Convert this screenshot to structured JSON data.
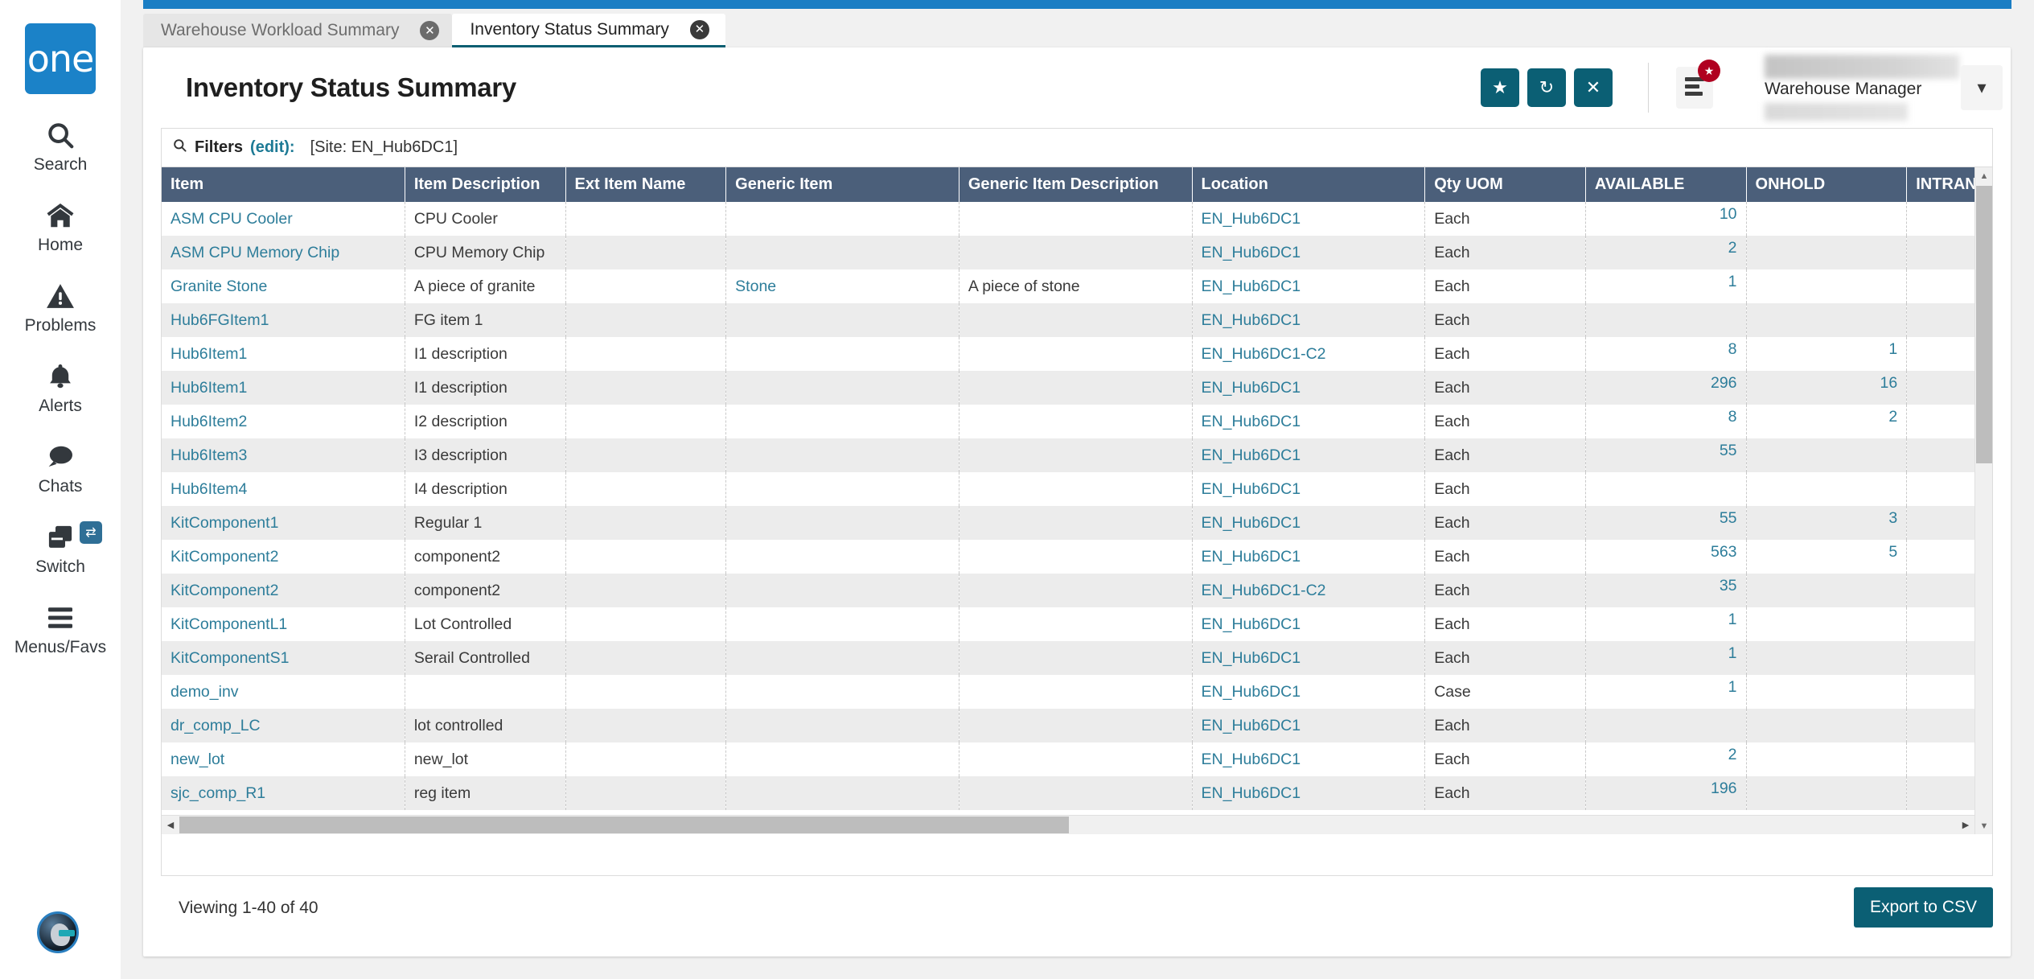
{
  "brand": {
    "logo_text": "one"
  },
  "sidebar": {
    "items": [
      {
        "label": "Search",
        "icon": "search-icon"
      },
      {
        "label": "Home",
        "icon": "home-icon"
      },
      {
        "label": "Problems",
        "icon": "warning-triangle-icon"
      },
      {
        "label": "Alerts",
        "icon": "bell-icon"
      },
      {
        "label": "Chats",
        "icon": "chat-bubble-icon"
      },
      {
        "label": "Switch",
        "icon": "windows-switch-icon",
        "badge_icon": "swap-arrows-icon"
      },
      {
        "label": "Menus/Favs",
        "icon": "hamburger-icon"
      }
    ]
  },
  "tabs": [
    {
      "label": "Warehouse Workload Summary",
      "active": false,
      "close_icon": "close-circle-icon"
    },
    {
      "label": "Inventory Status Summary",
      "active": true,
      "close_icon": "close-circle-icon"
    }
  ],
  "header": {
    "title": "Inventory Status Summary",
    "actions": [
      {
        "name": "favorite-button",
        "icon": "star-icon",
        "glyph": "★"
      },
      {
        "name": "refresh-button",
        "icon": "refresh-icon",
        "glyph": "↻"
      },
      {
        "name": "close-button",
        "icon": "x-icon",
        "glyph": "✕"
      }
    ],
    "menu_button": {
      "icon": "menu-list-icon",
      "badge_icon": "star-badge-icon",
      "badge_glyph": "★"
    },
    "user": {
      "role": "Warehouse Manager",
      "caret_icon": "chevron-down-icon",
      "caret_glyph": "▾"
    }
  },
  "filters": {
    "icon": "search-icon",
    "label": "Filters",
    "edit_link": "(edit):",
    "value": "[Site: EN_Hub6DC1]"
  },
  "table": {
    "columns": [
      "Item",
      "Item Description",
      "Ext Item Name",
      "Generic Item",
      "Generic Item Description",
      "Location",
      "Qty UOM",
      "AVAILABLE",
      "ONHOLD",
      "INTRANSIT"
    ],
    "rows": [
      {
        "item": "ASM CPU Cooler",
        "desc": "CPU Cooler",
        "ext": "",
        "generic": "",
        "generic_desc": "",
        "location": "EN_Hub6DC1",
        "uom": "Each",
        "available": "10",
        "onhold": "",
        "intransit": ""
      },
      {
        "item": "ASM CPU Memory Chip",
        "desc": "CPU Memory Chip",
        "ext": "",
        "generic": "",
        "generic_desc": "",
        "location": "EN_Hub6DC1",
        "uom": "Each",
        "available": "2",
        "onhold": "",
        "intransit": ""
      },
      {
        "item": "Granite Stone",
        "desc": "A piece of granite",
        "ext": "",
        "generic": "Stone",
        "generic_desc": "A piece of stone",
        "location": "EN_Hub6DC1",
        "uom": "Each",
        "available": "1",
        "onhold": "",
        "intransit": ""
      },
      {
        "item": "Hub6FGItem1",
        "desc": "FG item 1",
        "ext": "",
        "generic": "",
        "generic_desc": "",
        "location": "EN_Hub6DC1",
        "uom": "Each",
        "available": "",
        "onhold": "",
        "intransit": ""
      },
      {
        "item": "Hub6Item1",
        "desc": "I1 description",
        "ext": "",
        "generic": "",
        "generic_desc": "",
        "location": "EN_Hub6DC1-C2",
        "uom": "Each",
        "available": "8",
        "onhold": "1",
        "intransit": ""
      },
      {
        "item": "Hub6Item1",
        "desc": "I1 description",
        "ext": "",
        "generic": "",
        "generic_desc": "",
        "location": "EN_Hub6DC1",
        "uom": "Each",
        "available": "296",
        "onhold": "16",
        "intransit": ""
      },
      {
        "item": "Hub6Item2",
        "desc": "I2 description",
        "ext": "",
        "generic": "",
        "generic_desc": "",
        "location": "EN_Hub6DC1",
        "uom": "Each",
        "available": "8",
        "onhold": "2",
        "intransit": ""
      },
      {
        "item": "Hub6Item3",
        "desc": "I3 description",
        "ext": "",
        "generic": "",
        "generic_desc": "",
        "location": "EN_Hub6DC1",
        "uom": "Each",
        "available": "55",
        "onhold": "",
        "intransit": ""
      },
      {
        "item": "Hub6Item4",
        "desc": "I4 description",
        "ext": "",
        "generic": "",
        "generic_desc": "",
        "location": "EN_Hub6DC1",
        "uom": "Each",
        "available": "",
        "onhold": "",
        "intransit": ""
      },
      {
        "item": "KitComponent1",
        "desc": "Regular 1",
        "ext": "",
        "generic": "",
        "generic_desc": "",
        "location": "EN_Hub6DC1",
        "uom": "Each",
        "available": "55",
        "onhold": "3",
        "intransit": ""
      },
      {
        "item": "KitComponent2",
        "desc": "component2",
        "ext": "",
        "generic": "",
        "generic_desc": "",
        "location": "EN_Hub6DC1",
        "uom": "Each",
        "available": "563",
        "onhold": "5",
        "intransit": ""
      },
      {
        "item": "KitComponent2",
        "desc": "component2",
        "ext": "",
        "generic": "",
        "generic_desc": "",
        "location": "EN_Hub6DC1-C2",
        "uom": "Each",
        "available": "35",
        "onhold": "",
        "intransit": ""
      },
      {
        "item": "KitComponentL1",
        "desc": "Lot Controlled",
        "ext": "",
        "generic": "",
        "generic_desc": "",
        "location": "EN_Hub6DC1",
        "uom": "Each",
        "available": "1",
        "onhold": "",
        "intransit": ""
      },
      {
        "item": "KitComponentS1",
        "desc": "Serail Controlled",
        "ext": "",
        "generic": "",
        "generic_desc": "",
        "location": "EN_Hub6DC1",
        "uom": "Each",
        "available": "1",
        "onhold": "",
        "intransit": ""
      },
      {
        "item": "demo_inv",
        "desc": "",
        "ext": "",
        "generic": "",
        "generic_desc": "",
        "location": "EN_Hub6DC1",
        "uom": "Case",
        "available": "1",
        "onhold": "",
        "intransit": ""
      },
      {
        "item": "dr_comp_LC",
        "desc": "lot controlled",
        "ext": "",
        "generic": "",
        "generic_desc": "",
        "location": "EN_Hub6DC1",
        "uom": "Each",
        "available": "",
        "onhold": "",
        "intransit": ""
      },
      {
        "item": "new_lot",
        "desc": "new_lot",
        "ext": "",
        "generic": "",
        "generic_desc": "",
        "location": "EN_Hub6DC1",
        "uom": "Each",
        "available": "2",
        "onhold": "",
        "intransit": ""
      },
      {
        "item": "sjc_comp_R1",
        "desc": "reg item",
        "ext": "",
        "generic": "",
        "generic_desc": "",
        "location": "EN_Hub6DC1",
        "uom": "Each",
        "available": "196",
        "onhold": "",
        "intransit": ""
      }
    ]
  },
  "footer": {
    "viewing_text": "Viewing 1-40 of 40",
    "export_label": "Export to CSV"
  },
  "colors": {
    "brand_blue": "#1b82c8",
    "top_bar_blue": "#1b7ec4",
    "teal_action": "#0b5f74",
    "table_header": "#4b5f7a",
    "link_blue": "#2d7d9a",
    "badge_red": "#b00020"
  }
}
